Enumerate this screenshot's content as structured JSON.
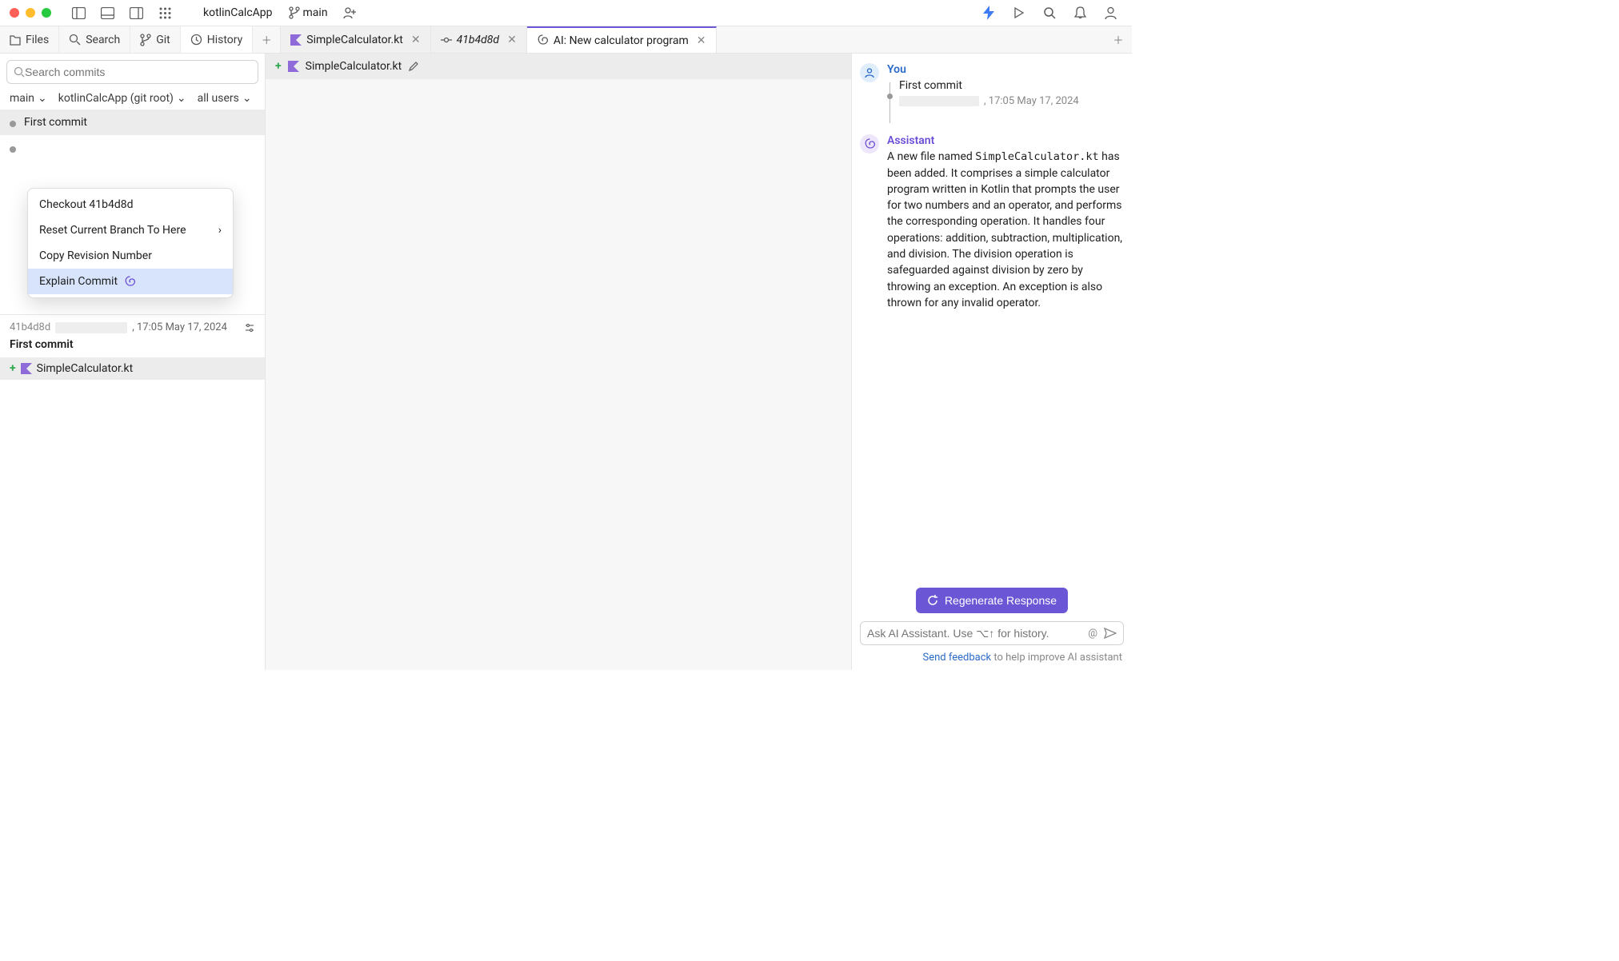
{
  "titlebar": {
    "project": "kotlinCalcApp",
    "branch": "main"
  },
  "tool_tabs": {
    "files": "Files",
    "search": "Search",
    "git": "Git",
    "history": "History"
  },
  "editor_tabs": {
    "file": "SimpleCalculator.kt",
    "commit": "41b4d8d",
    "ai": "AI: New calculator program"
  },
  "search_commits": {
    "placeholder": "Search commits"
  },
  "filters": {
    "branch": "main",
    "root": "kotlinCalcApp (git root)",
    "users": "all users"
  },
  "commits": {
    "first": "First commit"
  },
  "context_menu": {
    "checkout": "Checkout 41b4d8d",
    "reset": "Reset Current Branch To Here",
    "copy": "Copy Revision Number",
    "explain": "Explain Commit"
  },
  "commit_details": {
    "hash": "41b4d8d",
    "timestamp": ", 17:05 May 17, 2024",
    "title": "First commit",
    "file": "SimpleCalculator.kt"
  },
  "mid": {
    "file": "SimpleCalculator.kt"
  },
  "ai": {
    "you_label": "You",
    "you_commit_title": "First commit",
    "you_commit_meta": ", 17:05 May 17, 2024",
    "assistant_label": "Assistant",
    "assistant_text_1": "A new file named ",
    "assistant_code": "SimpleCalculator.kt",
    "assistant_text_2": " has been added. It comprises a simple calculator program written in Kotlin that prompts the user for two numbers and an operator, and performs the corresponding operation. It handles four operations: addition, subtraction, multiplication, and division. The division operation is safeguarded against division by zero by throwing an exception. An exception is also thrown for any invalid operator.",
    "regenerate": "Regenerate Response",
    "input_placeholder": "Ask AI Assistant. Use ⌥↑ for history.",
    "feedback_link": "Send feedback",
    "feedback_rest": " to help improve AI assistant"
  }
}
